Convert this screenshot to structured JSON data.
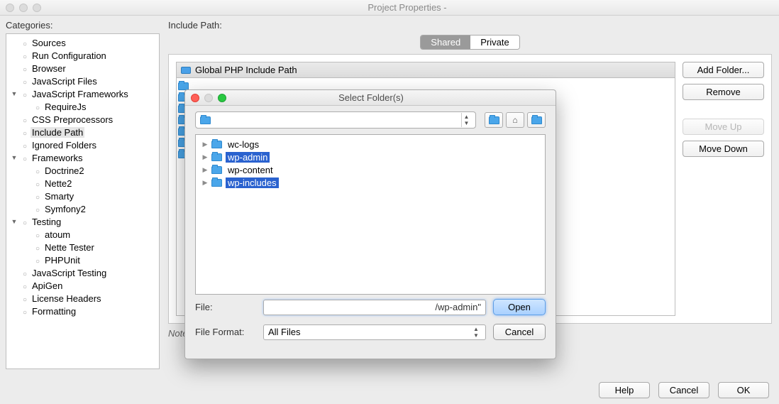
{
  "window": {
    "title": "Project Properties -"
  },
  "categories": {
    "label": "Categories:",
    "tree": [
      {
        "label": "Sources",
        "depth": 1,
        "bullet": true
      },
      {
        "label": "Run Configuration",
        "depth": 1,
        "bullet": true
      },
      {
        "label": "Browser",
        "depth": 1,
        "bullet": true
      },
      {
        "label": "JavaScript Files",
        "depth": 1,
        "bullet": true
      },
      {
        "label": "JavaScript Frameworks",
        "depth": 1,
        "bullet": true,
        "expand": "down"
      },
      {
        "label": "RequireJs",
        "depth": 2,
        "bullet": true
      },
      {
        "label": "CSS Preprocessors",
        "depth": 1,
        "bullet": true
      },
      {
        "label": "Include Path",
        "depth": 1,
        "bullet": true,
        "selected": true
      },
      {
        "label": "Ignored Folders",
        "depth": 1,
        "bullet": true
      },
      {
        "label": "Frameworks",
        "depth": 1,
        "bullet": true,
        "expand": "down"
      },
      {
        "label": "Doctrine2",
        "depth": 2,
        "bullet": true
      },
      {
        "label": "Nette2",
        "depth": 2,
        "bullet": true
      },
      {
        "label": "Smarty",
        "depth": 2,
        "bullet": true
      },
      {
        "label": "Symfony2",
        "depth": 2,
        "bullet": true
      },
      {
        "label": "Testing",
        "depth": 1,
        "bullet": true,
        "expand": "down"
      },
      {
        "label": "atoum",
        "depth": 2,
        "bullet": true
      },
      {
        "label": "Nette Tester",
        "depth": 2,
        "bullet": true
      },
      {
        "label": "PHPUnit",
        "depth": 2,
        "bullet": true
      },
      {
        "label": "JavaScript Testing",
        "depth": 1,
        "bullet": true
      },
      {
        "label": "ApiGen",
        "depth": 1,
        "bullet": true
      },
      {
        "label": "License Headers",
        "depth": 1,
        "bullet": true
      },
      {
        "label": "Formatting",
        "depth": 1,
        "bullet": true
      }
    ]
  },
  "includePath": {
    "label": "Include Path:",
    "tabs": {
      "shared": "Shared",
      "private": "Private"
    },
    "listHeader": "Global PHP Include Path",
    "folderRows": 7,
    "buttons": {
      "add": "Add Folder...",
      "remove": "Remove",
      "moveUp": "Move Up",
      "moveDown": "Move Down"
    },
    "note": "Note: Include Path is used only by NetBeans."
  },
  "footer": {
    "help": "Help",
    "cancel": "Cancel",
    "ok": "OK"
  },
  "dialog": {
    "title": "Select Folder(s)",
    "pathValue": "",
    "toolbarIcons": [
      "up-icon",
      "home-icon",
      "newfolder-icon"
    ],
    "folders": [
      {
        "name": "wc-logs",
        "selected": false
      },
      {
        "name": "wp-admin",
        "selected": true
      },
      {
        "name": "wp-content",
        "selected": false
      },
      {
        "name": "wp-includes",
        "selected": true
      }
    ],
    "fileLabel": "File:",
    "fileValue": "/wp-admin\"",
    "formatLabel": "File Format:",
    "formatValue": "All Files",
    "open": "Open",
    "cancel": "Cancel"
  }
}
